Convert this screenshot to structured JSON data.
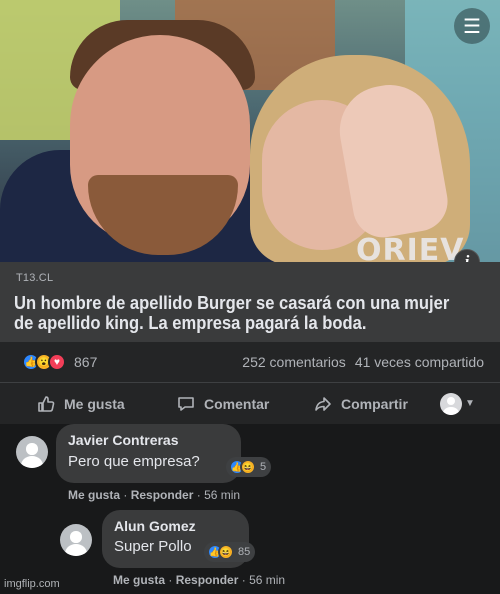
{
  "photo": {
    "watermark": "ORIEV",
    "info_icon": "i",
    "menu_icon": "menu-icon"
  },
  "link_preview": {
    "source": "T13.CL",
    "headline_line1": "Un hombre de apellido Burger se casará con una mujer",
    "headline_line2": "de apellido king. La empresa pagará la boda."
  },
  "post_stats": {
    "reaction_icons": [
      "like-icon",
      "wow-icon",
      "love-icon"
    ],
    "reaction_count": "867",
    "comments": "252 comentarios",
    "shares": "41 veces compartido"
  },
  "action_bar": {
    "like_label": "Me gusta",
    "comment_label": "Comentar",
    "share_label": "Compartir"
  },
  "comments": [
    {
      "author": "Javier  Contreras",
      "text": "Pero que empresa?",
      "reaction_count": "5",
      "like_label": "Me gusta",
      "reply_label": "Responder",
      "time": "56 min"
    },
    {
      "author": "Alun Gomez",
      "text": "Super Pollo",
      "reaction_count": "85",
      "like_label": "Me gusta",
      "reply_label": "Responder",
      "time": "56 min"
    }
  ],
  "footer_watermark": "imgflip.com",
  "colors": {
    "background": "#18191a",
    "card": "#242526",
    "bubble": "#3a3b3c",
    "like_blue": "#2d88ff",
    "love_red": "#f33e58",
    "wow_yellow": "#f7b125"
  }
}
